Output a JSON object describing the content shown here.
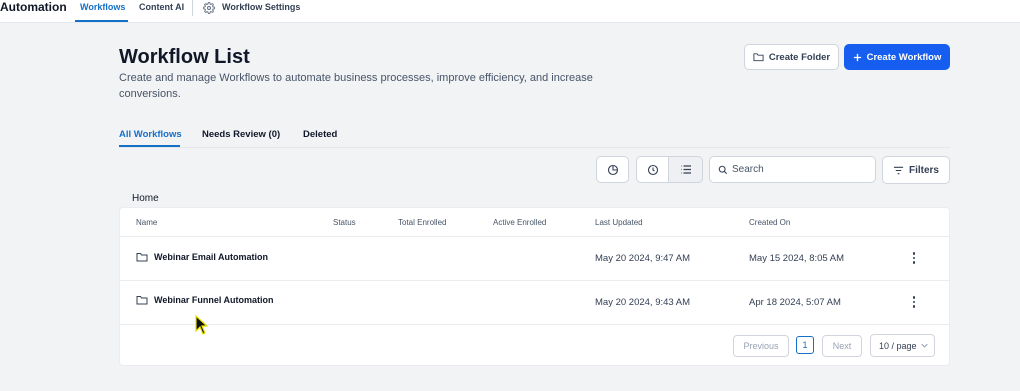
{
  "topnav": {
    "brand": "Automation",
    "tabs": [
      {
        "label": "Workflows",
        "active": true
      },
      {
        "label": "Content AI",
        "active": false
      }
    ],
    "settings_label": "Workflow Settings",
    "settings_icon": "gear-icon"
  },
  "header": {
    "title": "Workflow List",
    "description": "Create and manage Workflows to automate business processes, improve efficiency, and increase conversions.",
    "create_folder_label": "Create Folder",
    "create_workflow_label": "Create Workflow"
  },
  "tabs": [
    {
      "label": "All Workflows",
      "active": true
    },
    {
      "label": "Needs Review (0)",
      "active": false
    },
    {
      "label": "Deleted",
      "active": false
    }
  ],
  "toolbar": {
    "search_placeholder": "Search",
    "filters_label": "Filters"
  },
  "breadcrumb": "Home",
  "table": {
    "columns": [
      "Name",
      "Status",
      "Total Enrolled",
      "Active Enrolled",
      "Last Updated",
      "Created On"
    ],
    "rows": [
      {
        "name": "Webinar Email Automation",
        "status": "",
        "total_enrolled": "",
        "active_enrolled": "",
        "last_updated": "May 20 2024, 9:47 AM",
        "created_on": "May 15 2024, 8:05 AM"
      },
      {
        "name": "Webinar Funnel Automation",
        "status": "",
        "total_enrolled": "",
        "active_enrolled": "",
        "last_updated": "May 20 2024, 9:43 AM",
        "created_on": "Apr 18 2024, 5:07 AM"
      }
    ]
  },
  "pagination": {
    "previous_label": "Previous",
    "current_page": "1",
    "next_label": "Next",
    "page_size_label": "10 / page"
  },
  "colors": {
    "accent": "#1570c7",
    "primary_button": "#155eef"
  }
}
